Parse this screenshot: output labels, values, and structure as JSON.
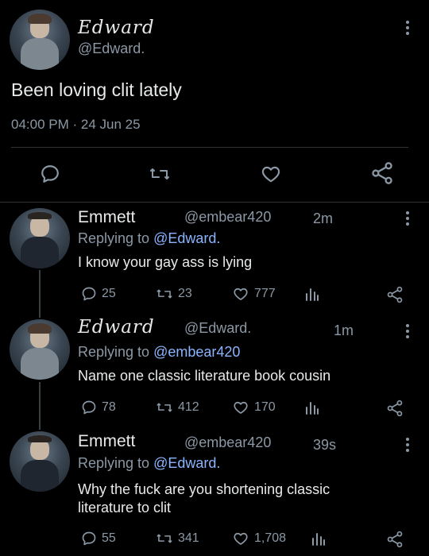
{
  "main": {
    "name": "Edward",
    "handle": "@Edward.",
    "text": "Been loving clit lately",
    "time": "04:00 PM",
    "sep": "·",
    "date": "24 Jun 25"
  },
  "replies": [
    {
      "name": "Emmett",
      "handle": "@embear420",
      "age": "2m",
      "reply_prefix": "Replying to",
      "reply_to": "@Edward.",
      "text": "I know your gay ass is lying",
      "comments": "25",
      "retweets": "23",
      "likes": "777"
    },
    {
      "name": "Edward",
      "handle": "@Edward.",
      "age": "1m",
      "reply_prefix": "Replying to",
      "reply_to": "@embear420",
      "text": "Name one classic literature book cousin",
      "comments": "78",
      "retweets": "412",
      "likes": "170"
    },
    {
      "name": "Emmett",
      "handle": "@embear420",
      "age": "39s",
      "reply_prefix": "Replying to",
      "reply_to": "@Edward.",
      "text_line1": "Why the fuck are you shortening classic",
      "text_line2": "literature to clit",
      "comments": "55",
      "retweets": "341",
      "likes": "1,708"
    }
  ],
  "icons": {
    "comment": "comment-icon",
    "retweet": "retweet-icon",
    "like": "heart-icon",
    "views": "views-icon",
    "share": "share-icon",
    "more": "more-icon"
  },
  "colors": {
    "background": "#000000",
    "text": "#e7e9ea",
    "muted": "#8b98a5",
    "link": "#8ab4ff"
  }
}
